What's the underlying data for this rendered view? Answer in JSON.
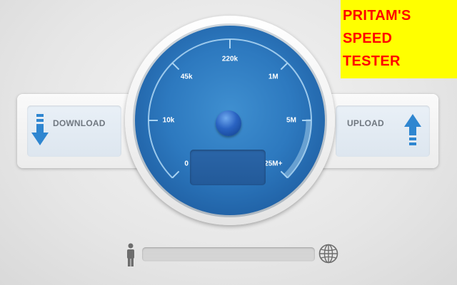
{
  "title": {
    "lines": [
      "PRITAM'S",
      "SPEED",
      "TESTER"
    ],
    "text_color": "#ff0000",
    "background": "#ffff00"
  },
  "download": {
    "label": "DOWNLOAD",
    "icon": "download-arrow-icon"
  },
  "upload": {
    "label": "UPLOAD",
    "icon": "upload-arrow-icon"
  },
  "gauge": {
    "scale_labels": [
      "0",
      "10k",
      "45k",
      "220k",
      "1M",
      "5M",
      "25M+"
    ],
    "accent": "#2d79bf"
  },
  "progress": {
    "value": 0,
    "left_icon": "person-icon",
    "right_icon": "globe-icon"
  }
}
